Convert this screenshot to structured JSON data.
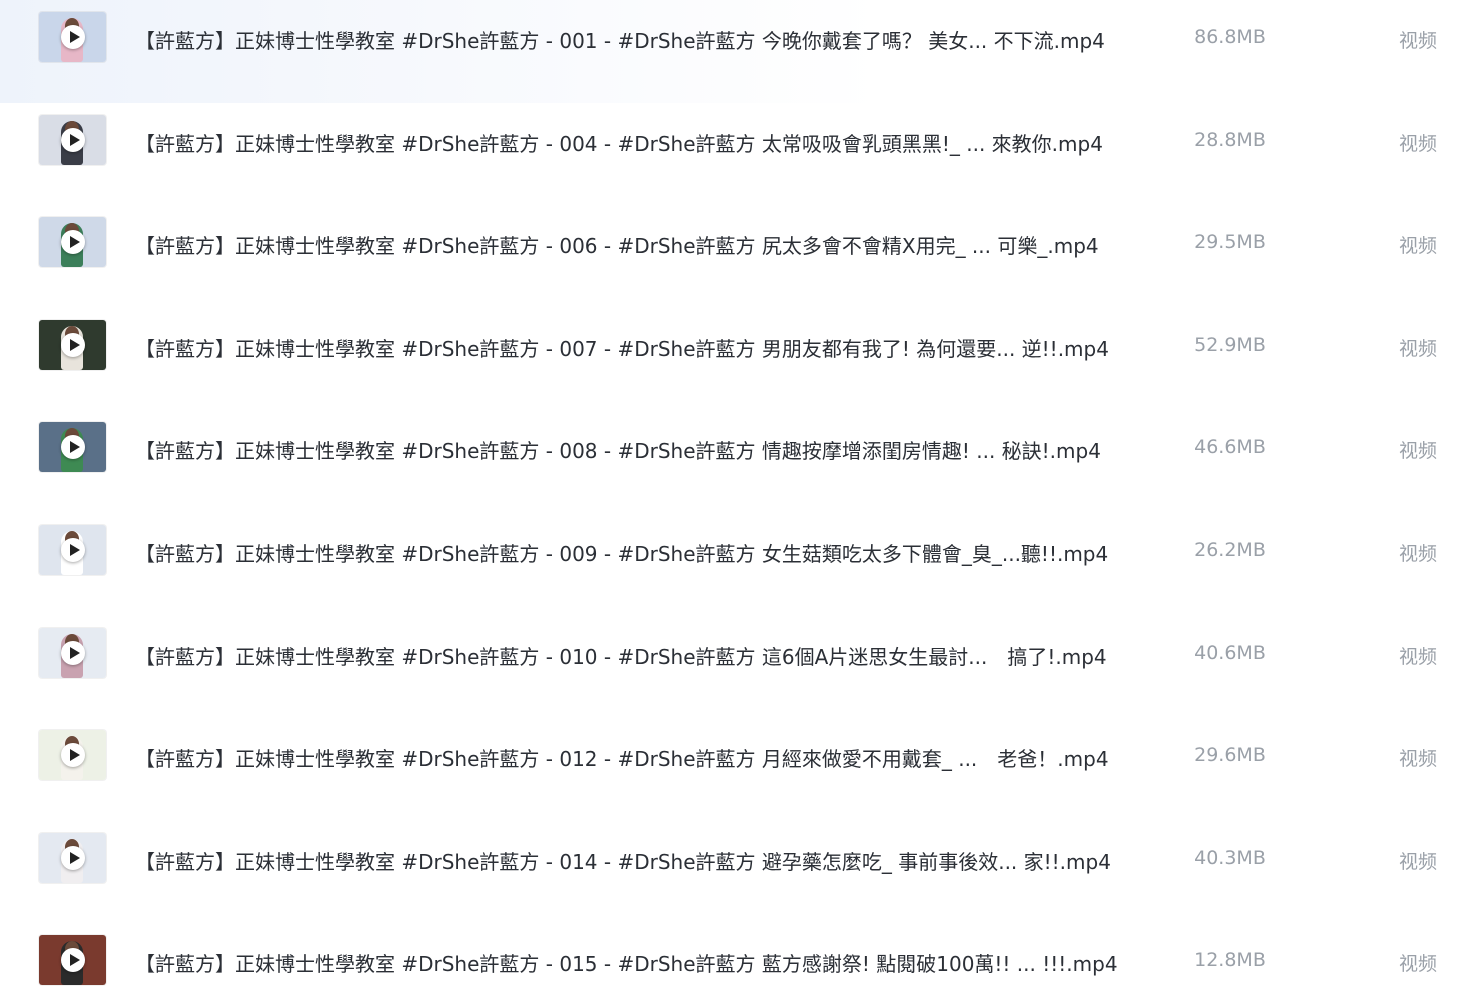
{
  "file_list": {
    "rows": [
      {
        "name": "【許藍方】正妹博士性學教室 #DrShe許藍方 - 001 - #DrShe許藍方 今晚你戴套了嗎？ 美女... 不下流.mp4",
        "size": "86.8MB",
        "type": "视频",
        "thumb_colors": {
          "bg": "#c9d6ea",
          "figure": "#e7b7c7"
        }
      },
      {
        "name": "【許藍方】正妹博士性學教室 #DrShe許藍方 - 004 - #DrShe許藍方 太常吸吸會乳頭黑黑!_ ... 來教你.mp4",
        "size": "28.8MB",
        "type": "视频",
        "thumb_colors": {
          "bg": "#d9dde6",
          "figure": "#3a3d47"
        }
      },
      {
        "name": "【許藍方】正妹博士性學教室 #DrShe許藍方 - 006 - #DrShe許藍方 尻太多會不會精X用完_ ... 可樂_.mp4",
        "size": "29.5MB",
        "type": "视频",
        "thumb_colors": {
          "bg": "#cfd9e8",
          "figure": "#3c7f5a"
        }
      },
      {
        "name": "【許藍方】正妹博士性學教室 #DrShe許藍方 - 007 - #DrShe許藍方 男朋友都有我了! 為何還要... 逆!!.mp4",
        "size": "52.9MB",
        "type": "视频",
        "thumb_colors": {
          "bg": "#2f3a2e",
          "figure": "#e8e4dc"
        }
      },
      {
        "name": "【許藍方】正妹博士性學教室 #DrShe許藍方 - 008 - #DrShe許藍方 情趣按摩增添閨房情趣! ... 秘訣!.mp4",
        "size": "46.6MB",
        "type": "视频",
        "thumb_colors": {
          "bg": "#5a7088",
          "figure": "#3e8a53"
        }
      },
      {
        "name": "【許藍方】正妹博士性學教室 #DrShe許藍方 - 009 - #DrShe許藍方 女生菇類吃太多下體會_臭_...聽!!.mp4",
        "size": "26.2MB",
        "type": "视频",
        "thumb_colors": {
          "bg": "#dfe5ee",
          "figure": "#ffffff"
        }
      },
      {
        "name": "【許藍方】正妹博士性學教室 #DrShe許藍方 - 010 - #DrShe許藍方 這6個A片迷思女生最討...　搞了!.mp4",
        "size": "40.6MB",
        "type": "视频",
        "thumb_colors": {
          "bg": "#e6ebf2",
          "figure": "#c9a2b0"
        }
      },
      {
        "name": "【許藍方】正妹博士性學教室 #DrShe許藍方 - 012 - #DrShe許藍方 月經來做愛不用戴套_ ...　老爸！.mp4",
        "size": "29.6MB",
        "type": "视频",
        "thumb_colors": {
          "bg": "#edf1e6",
          "figure": "#f4f2ec"
        }
      },
      {
        "name": "【許藍方】正妹博士性學教室 #DrShe許藍方 - 014 - #DrShe許藍方 避孕藥怎麼吃_ 事前事後效... 家!!.mp4",
        "size": "40.3MB",
        "type": "视频",
        "thumb_colors": {
          "bg": "#e4e9f1",
          "figure": "#f0eef0"
        }
      },
      {
        "name": "【許藍方】正妹博士性學教室 #DrShe許藍方 - 015 - #DrShe許藍方 藍方感謝祭! 點閱破100萬!! ... !!!.mp4",
        "size": "12.8MB",
        "type": "视频",
        "thumb_colors": {
          "bg": "#7a3a2e",
          "figure": "#2b2b2b"
        }
      }
    ]
  }
}
